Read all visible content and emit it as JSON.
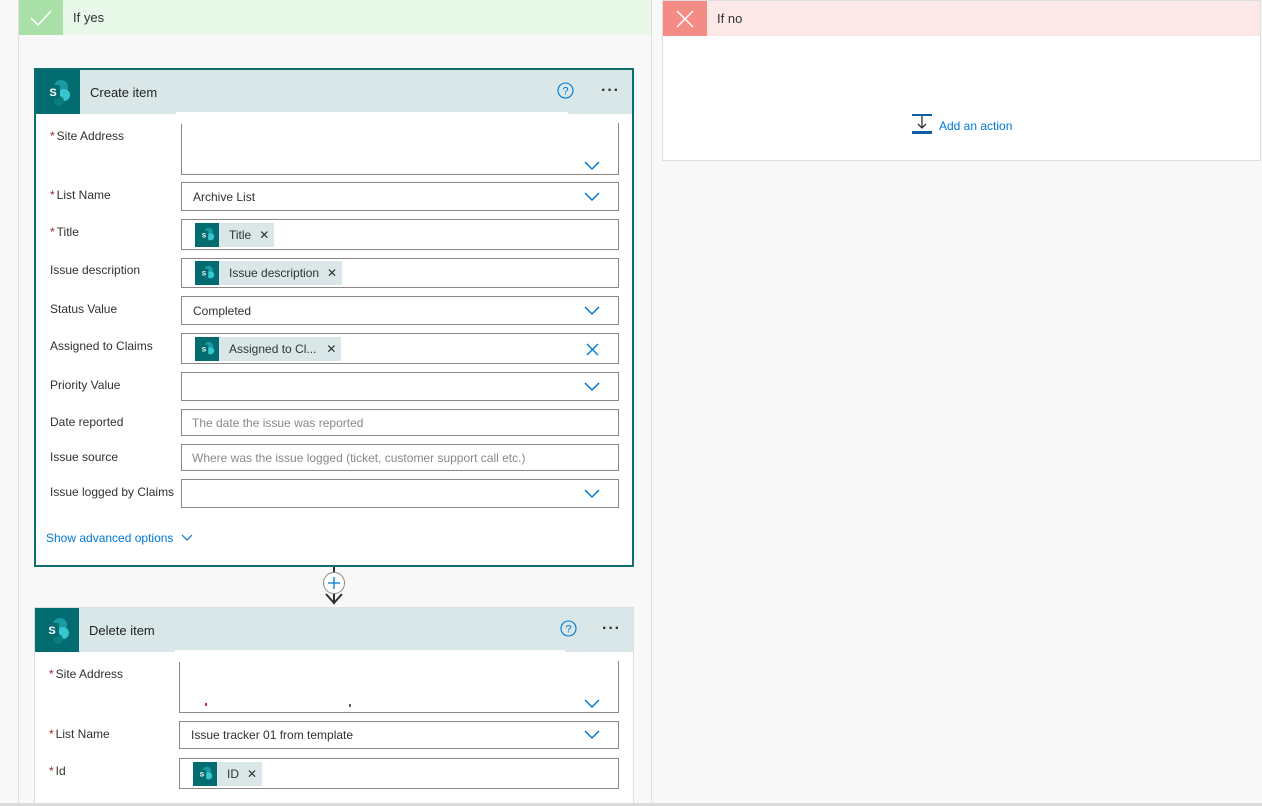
{
  "branches": {
    "yes_label": "If yes",
    "no_label": "If no",
    "add_action_label": "Add an action"
  },
  "create_item": {
    "title": "Create item",
    "fields": {
      "site_address_label": "Site Address",
      "list_name_label": "List Name",
      "list_name_value": "Archive List",
      "title_label": "Title",
      "title_token": "Title",
      "issue_description_label": "Issue description",
      "issue_description_token": "Issue description",
      "status_value_label": "Status Value",
      "status_value_value": "Completed",
      "assigned_to_label": "Assigned to Claims",
      "assigned_to_token": "Assigned to Cl...",
      "priority_value_label": "Priority Value",
      "date_reported_label": "Date reported",
      "date_reported_placeholder": "The date the issue was reported",
      "issue_source_label": "Issue source",
      "issue_source_placeholder": "Where was the issue logged (ticket, customer support call etc.)",
      "issue_logged_by_label": "Issue logged by Claims"
    },
    "advanced_label": "Show advanced options"
  },
  "delete_item": {
    "title": "Delete item",
    "fields": {
      "site_address_label": "Site Address",
      "list_name_label": "List Name",
      "list_name_value": "Issue tracker 01 from template",
      "id_label": "Id",
      "id_token": "ID"
    }
  },
  "icons": {
    "sharepoint": "sharepoint-icon",
    "check": "check-icon",
    "close": "close-icon",
    "help": "help-icon",
    "more": "more-icon",
    "chevron": "chevron-down-icon",
    "add_step": "plus-icon"
  },
  "colors": {
    "accent": "#0078d4",
    "sharepoint": "#036c70",
    "yes_header": "#e8f8e8",
    "no_header": "#fde8e8",
    "required": "#a4262c"
  }
}
